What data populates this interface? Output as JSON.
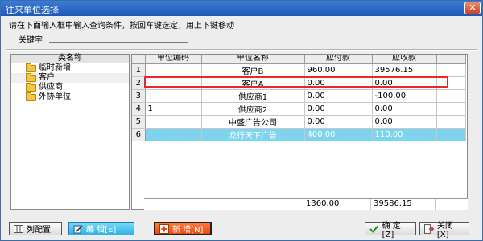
{
  "window": {
    "title": "往来单位选择",
    "close_label": "✕"
  },
  "search": {
    "hint": "请在下面输入框中输入查询条件，按回车键选定，用上下键移动",
    "keyword_label": "关键字",
    "keyword_value": ""
  },
  "tree": {
    "header": "类名称",
    "items": [
      {
        "label": "临时新增"
      },
      {
        "label": "客户"
      },
      {
        "label": "供应商"
      },
      {
        "label": "外协单位"
      }
    ]
  },
  "grid": {
    "columns": [
      "单位编码",
      "单位名称",
      "应付款",
      "应收款"
    ],
    "rows": [
      {
        "num": "1",
        "code": "",
        "name": "客户B",
        "payable": "960.00",
        "receivable": "39576.15"
      },
      {
        "num": "2",
        "code": "",
        "name": "客户A",
        "payable": "0.00",
        "receivable": "0.00"
      },
      {
        "num": "3",
        "code": "",
        "name": "供应商1",
        "payable": "0.00",
        "receivable": "-100.00"
      },
      {
        "num": "4",
        "code": "1",
        "name": "供应商2",
        "payable": "0.00",
        "receivable": "0.00"
      },
      {
        "num": "5",
        "code": "",
        "name": "中盛广告公司",
        "payable": "0.00",
        "receivable": "0.00"
      },
      {
        "num": "6",
        "code": "",
        "name": "龙行天下广告",
        "payable": "400.00",
        "receivable": "110.00"
      }
    ],
    "totals": {
      "payable": "1360.00",
      "receivable": "39586.15"
    }
  },
  "buttons": {
    "column_config": "列配置",
    "edit": "编 辑[E]",
    "add": "新 增[N]",
    "ok": "确 定[Z]",
    "close": "关闭[X]"
  },
  "colors": {
    "title_bar": "#1f59b6",
    "highlight_row": "#7ed3ef",
    "red_frame": "#e8282a",
    "edit_button": "#2eb2e4",
    "add_button": "#e84a10"
  }
}
